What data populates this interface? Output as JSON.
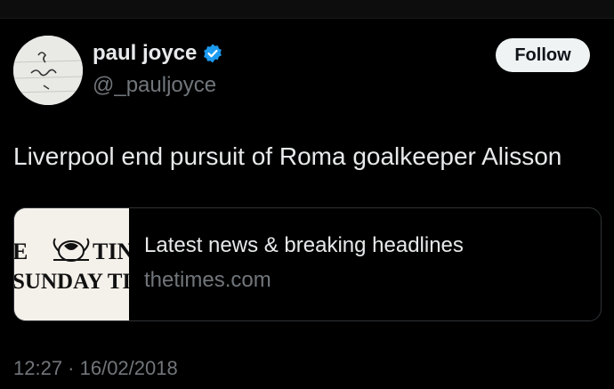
{
  "tweet": {
    "author_name": "paul joyce",
    "author_handle": "@_pauljoyce",
    "verified": true,
    "follow_label": "Follow",
    "text": "Liverpool end pursuit of Roma goalkeeper Alisson",
    "timestamp": "12:27 · 16/02/2018"
  },
  "link_card": {
    "title": "Latest news & breaking headlines",
    "domain": "thetimes.com",
    "thumbnail_text_line1": "E",
    "thumbnail_text_line1b": "TIN",
    "thumbnail_text_line2": "SUNDAY TI"
  },
  "colors": {
    "background": "#000000",
    "text_primary": "#e7e9ea",
    "text_secondary": "#71767b",
    "verified_blue": "#1d9bf0",
    "follow_bg": "#eff3f4"
  }
}
